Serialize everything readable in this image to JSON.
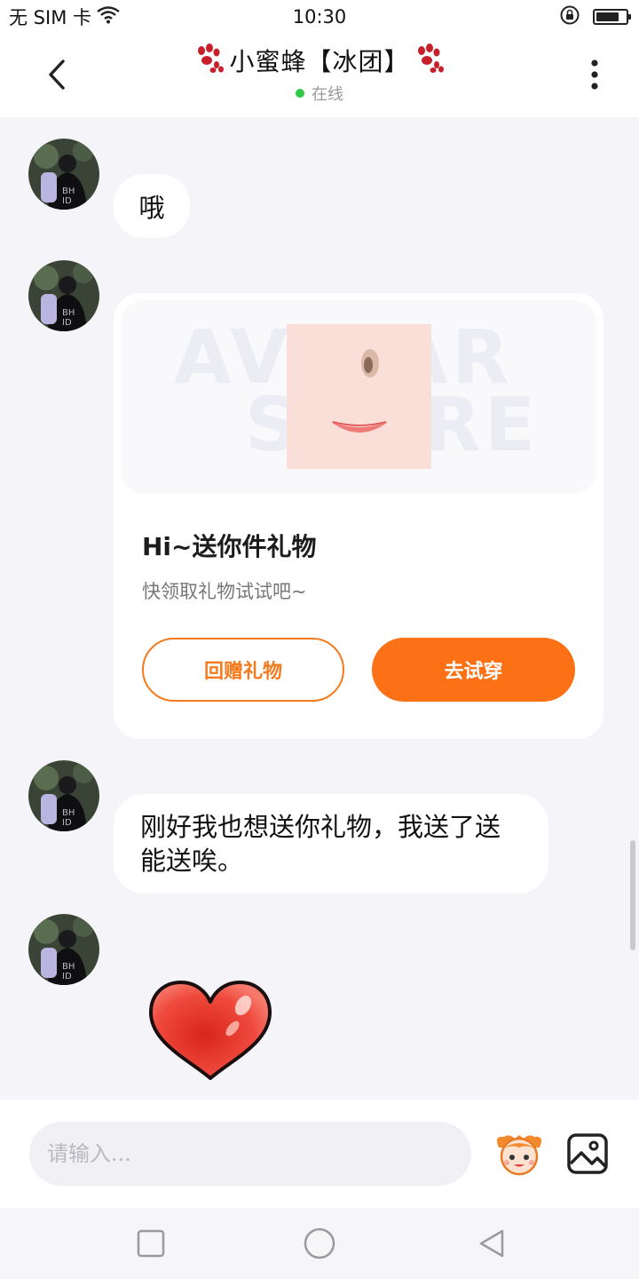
{
  "status_bar": {
    "carrier": "无 SIM 卡",
    "time": "10:30"
  },
  "header": {
    "title": "小蜜蜂【冰团】",
    "presence": "在线"
  },
  "messages": [
    {
      "text": "哦"
    },
    {
      "type": "gift_card",
      "title": "Hi~送你件礼物",
      "subtitle": "快领取礼物试试吧~",
      "watermark_line1": "AVATAR",
      "watermark_line2": "STORE",
      "return_gift_label": "回赠礼物",
      "try_on_label": "去试穿"
    },
    {
      "text_line1": "刚好我也想送你礼物，我送了送",
      "text_line2": "能送唉。"
    },
    {
      "type": "sticker",
      "sticker": "heart"
    }
  ],
  "input": {
    "placeholder": "请输入..."
  },
  "colors": {
    "accent": "#fc7115",
    "online": "#2ec946",
    "background": "#f5f5f9"
  }
}
